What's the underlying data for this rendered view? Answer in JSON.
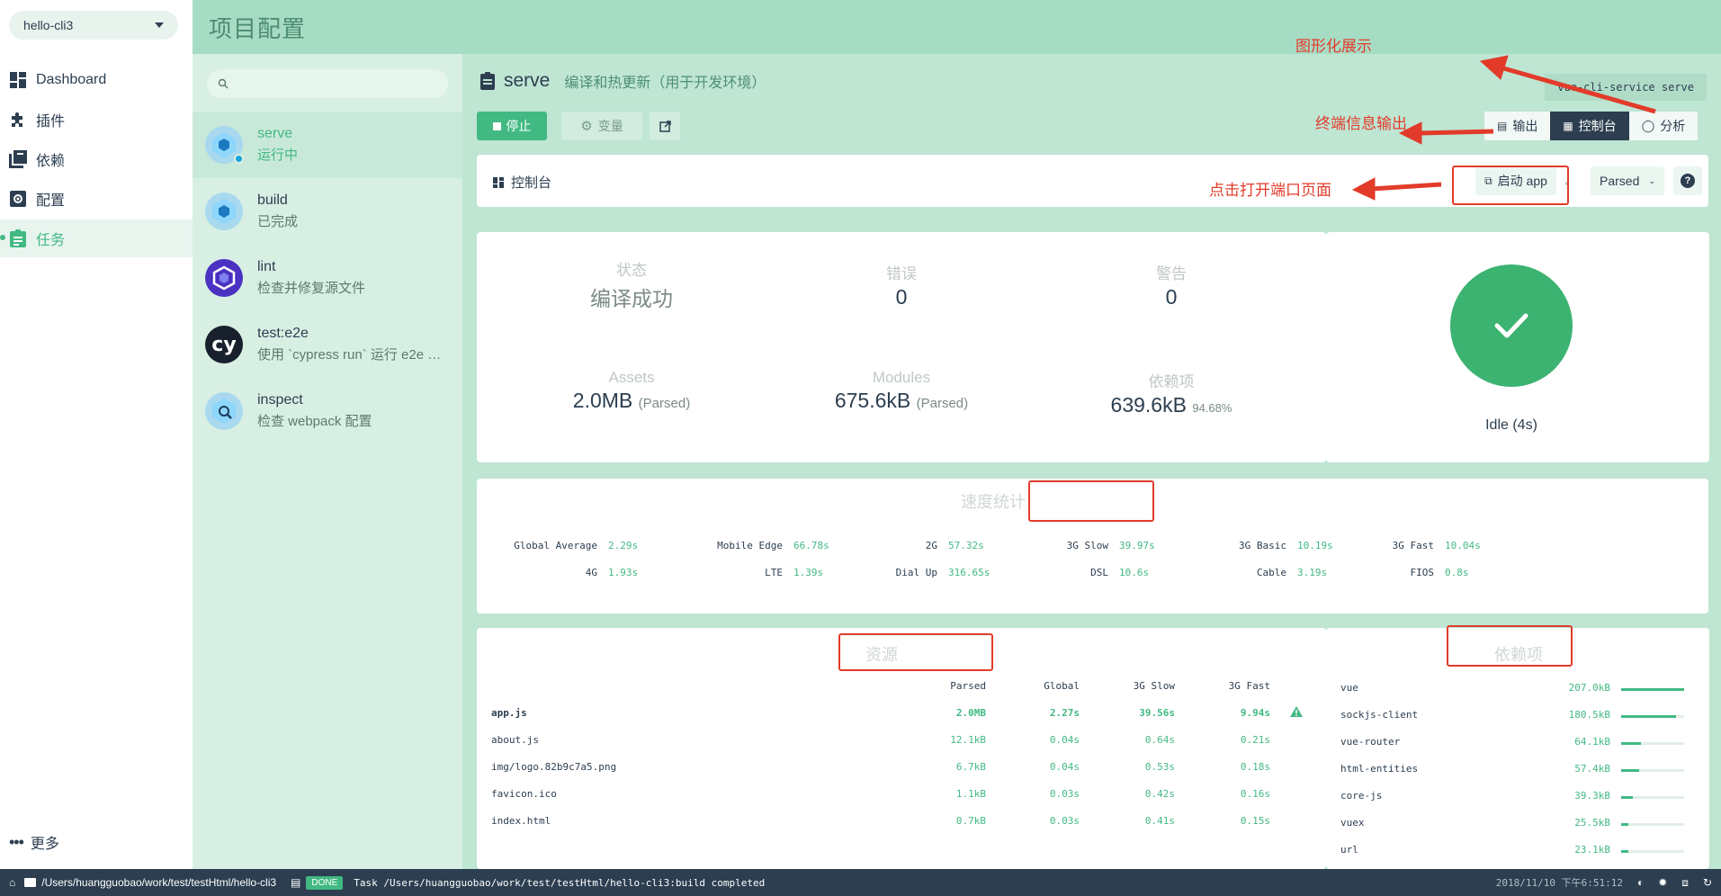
{
  "project": {
    "name": "hello-cli3"
  },
  "nav": {
    "items": [
      {
        "label": "Dashboard",
        "icon": "dashboard-icon"
      },
      {
        "label": "插件",
        "icon": "puzzle-icon"
      },
      {
        "label": "依赖",
        "icon": "library-icon"
      },
      {
        "label": "配置",
        "icon": "settings-icon"
      },
      {
        "label": "任务",
        "icon": "assignment-icon"
      }
    ],
    "more": "更多"
  },
  "header": {
    "title": "项目配置"
  },
  "search": {
    "placeholder": ""
  },
  "tasks": [
    {
      "name": "serve",
      "desc": "运行中"
    },
    {
      "name": "build",
      "desc": "已完成"
    },
    {
      "name": "lint",
      "desc": "检查并修复源文件"
    },
    {
      "name": "test:e2e",
      "desc": "使用 `cypress run` 运行 e2e 测试"
    },
    {
      "name": "inspect",
      "desc": "检查 webpack 配置"
    }
  ],
  "main": {
    "task_name": "serve",
    "task_desc": "编译和热更新（用于开发环境）",
    "stop_label": "停止",
    "vars_label": "变量",
    "command": "vue-cli-service serve",
    "tabs": [
      "输出",
      "控制台",
      "分析"
    ],
    "toolbar_title": "控制台",
    "launch_label": "启动 app",
    "parsed_select": "Parsed"
  },
  "stats": {
    "status_label": "状态",
    "status_value": "编译成功",
    "errors_label": "错误",
    "errors_value": "0",
    "warnings_label": "警告",
    "warnings_value": "0",
    "assets_label": "Assets",
    "assets_value": "2.0MB",
    "assets_sub": "(Parsed)",
    "modules_label": "Modules",
    "modules_value": "675.6kB",
    "modules_sub": "(Parsed)",
    "deps_label": "依赖项",
    "deps_value": "639.6kB",
    "deps_sub": "94.68%"
  },
  "status_card": {
    "text": "Idle (4s)"
  },
  "speed": {
    "title": "速度统计",
    "rows": [
      [
        {
          "k": "Global Average",
          "v": "2.29s"
        },
        {
          "k": "Mobile Edge",
          "v": "66.78s"
        },
        {
          "k": "2G",
          "v": "57.32s"
        },
        {
          "k": "3G Slow",
          "v": "39.97s"
        },
        {
          "k": "3G Basic",
          "v": "10.19s"
        },
        {
          "k": "3G Fast",
          "v": "10.04s"
        }
      ],
      [
        {
          "k": "4G",
          "v": "1.93s"
        },
        {
          "k": "LTE",
          "v": "1.39s"
        },
        {
          "k": "Dial Up",
          "v": "316.65s"
        },
        {
          "k": "DSL",
          "v": "10.6s"
        },
        {
          "k": "Cable",
          "v": "3.19s"
        },
        {
          "k": "FIOS",
          "v": "0.8s"
        }
      ]
    ]
  },
  "assets": {
    "title": "资源",
    "headers": [
      "Parsed",
      "Global",
      "3G Slow",
      "3G Fast"
    ],
    "rows": [
      {
        "name": "app.js",
        "cells": [
          "2.0MB",
          "2.27s",
          "39.56s",
          "9.94s"
        ]
      },
      {
        "name": "about.js",
        "cells": [
          "12.1kB",
          "0.04s",
          "0.64s",
          "0.21s"
        ]
      },
      {
        "name": "img/logo.82b9c7a5.png",
        "cells": [
          "6.7kB",
          "0.04s",
          "0.53s",
          "0.18s"
        ]
      },
      {
        "name": "favicon.ico",
        "cells": [
          "1.1kB",
          "0.03s",
          "0.42s",
          "0.16s"
        ]
      },
      {
        "name": "index.html",
        "cells": [
          "0.7kB",
          "0.03s",
          "0.41s",
          "0.15s"
        ]
      }
    ]
  },
  "deps": {
    "title": "依赖项",
    "rows": [
      {
        "name": "vue",
        "size": "207.0kB",
        "fraction": 1.0
      },
      {
        "name": "sockjs-client",
        "size": "180.5kB",
        "fraction": 0.87
      },
      {
        "name": "vue-router",
        "size": "64.1kB",
        "fraction": 0.31
      },
      {
        "name": "html-entities",
        "size": "57.4kB",
        "fraction": 0.28
      },
      {
        "name": "core-js",
        "size": "39.3kB",
        "fraction": 0.19
      },
      {
        "name": "vuex",
        "size": "25.5kB",
        "fraction": 0.12
      },
      {
        "name": "url",
        "size": "23.1kB",
        "fraction": 0.11
      }
    ]
  },
  "annotations": {
    "graph": "图形化展示",
    "terminal": "终端信息输出",
    "open_port": "点击打开端口页面"
  },
  "statusbar": {
    "path": "/Users/huangguobao/work/test/testHtml/hello-cli3",
    "done": "DONE",
    "message": "Task /Users/huangguobao/work/test/testHtml/hello-cli3:build completed",
    "datetime": "2018/11/10 下午6:51:12"
  },
  "colors": {
    "accent": "#42b983",
    "dark": "#2c3e50",
    "annotation": "#e23b2a"
  }
}
